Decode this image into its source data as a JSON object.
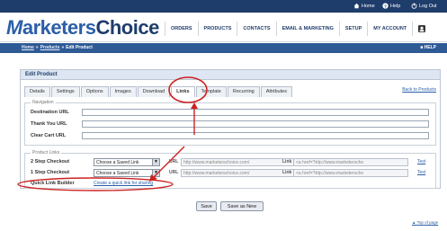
{
  "topbar": {
    "home_label": "Home",
    "help_label": "Help",
    "logout_label": "Log Out",
    "icon_names": [
      "home-icon",
      "help-icon",
      "power-icon"
    ]
  },
  "header": {
    "logo_mark": "M",
    "logo_text_1": "arketers",
    "logo_text_2": "Choice",
    "nav": [
      "ORDERS",
      "PRODUCTS",
      "CONTACTS",
      "EMAIL & MARKETING",
      "SETUP",
      "MY ACCOUNT"
    ],
    "account_icon": "account-square-icon"
  },
  "breadcrumb": {
    "items": [
      "Home",
      "Products",
      "Edit Product"
    ],
    "separator": "»",
    "help_label": "HELP",
    "help_icon": "help-small-icon"
  },
  "panel": {
    "title": "Edit Product",
    "back_link": "Back to Products",
    "tabs": [
      "Details",
      "Settings",
      "Options",
      "Images",
      "Download",
      "Links",
      "Template",
      "Recurring",
      "Attributes"
    ],
    "active_tab": "Links"
  },
  "navigation": {
    "legend": "Navigation",
    "rows": [
      {
        "label": "Destination URL",
        "value": ""
      },
      {
        "label": "Thank You URL",
        "value": ""
      },
      {
        "label": "Clear Cart URL",
        "value": ""
      }
    ]
  },
  "product_links": {
    "legend": "Product Links",
    "rows": [
      {
        "label": "2 Step Checkout",
        "select_value": "Choose a Saved Link",
        "url_label": "URL",
        "url_value": "http://www.marketerschoice.com/",
        "link_label": "Link",
        "link_value": "<a href=\"http://www.marketerscho",
        "test_label": "Test"
      },
      {
        "label": "1 Step Checkout",
        "select_value": "Choose a Saved Link",
        "url_label": "URL",
        "url_value": "http://www.marketerschoice.com/",
        "link_label": "Link",
        "link_value": "<a href=\"http://www.marketerscho",
        "test_label": "Test"
      }
    ],
    "quick_link_label": "Quick Link Builder",
    "quick_link_text": "Create a quick link for sharing"
  },
  "actions": {
    "save_label": "Save",
    "save_new_label": "Save as New"
  },
  "footer": {
    "top_of_page": "Top of page",
    "top_icon": "top-of-page-icon"
  },
  "colors": {
    "topbar": "#1f3d6b",
    "crumbbar": "#2e5a95",
    "accent": "#2b5ea8",
    "annotation_red": "#cc2222"
  }
}
